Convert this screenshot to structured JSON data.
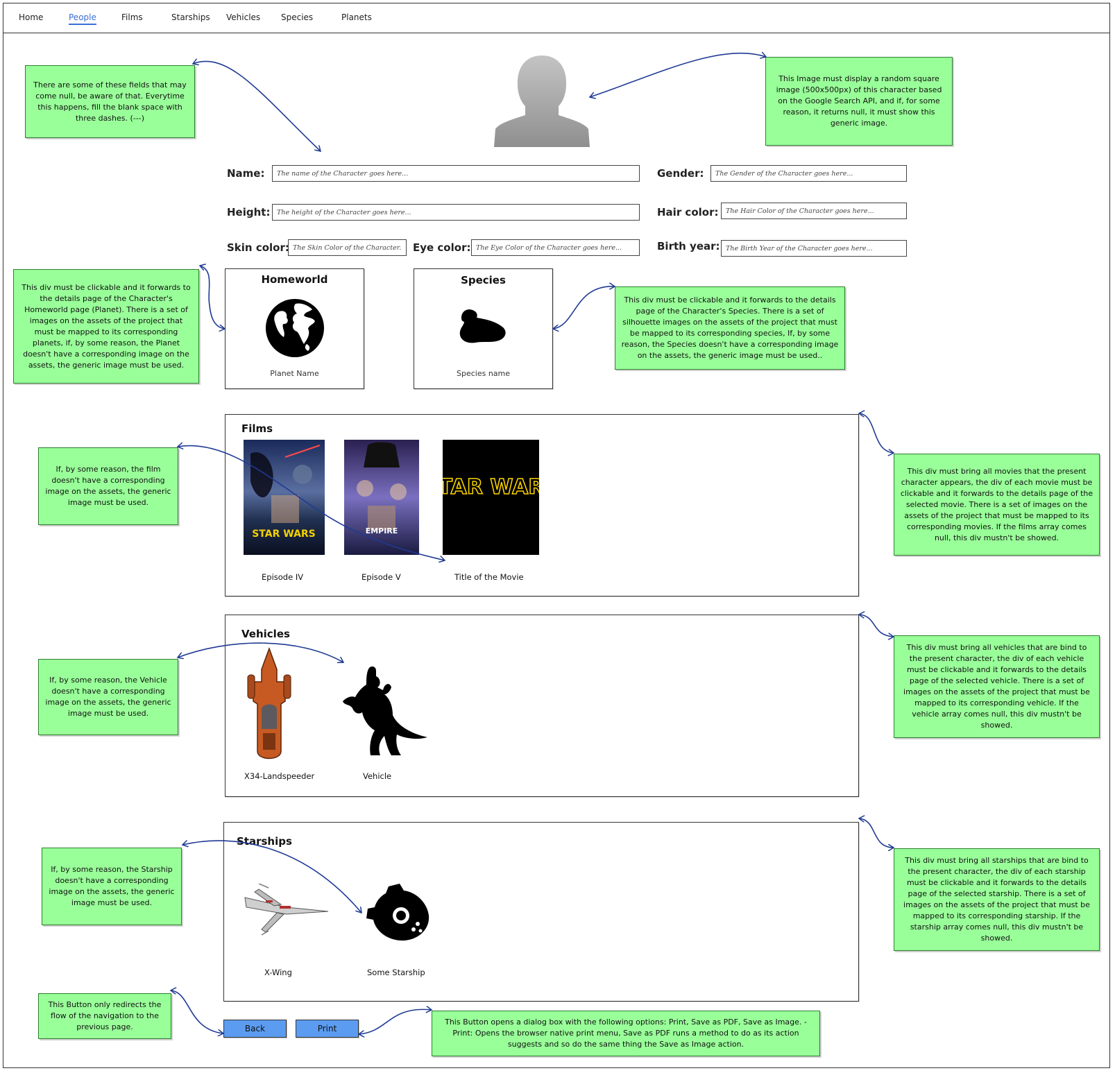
{
  "nav": {
    "items": [
      "Home",
      "People",
      "Films",
      "Starships",
      "Vehicles",
      "Species",
      "Planets"
    ],
    "active": "People"
  },
  "notes": {
    "null_fields": "There are some of these fields that may come null, be aware of that. Everytime this happens, fill the blank space with three dashes. (---)",
    "image": "This Image must display a random square image (500x500px) of this character based on the Google Search API, and if, for some reason, it returns null, it must show this generic image.",
    "homeworld": "This div must be clickable and it forwards to the details page of the Character's Homeworld page (Planet). There is a set of images on the assets of the project that must be mapped to its corresponding planets, if, by some reason, the Planet doesn't have a corresponding image on the assets, the generic image must be used.",
    "species": "This div must be clickable and it forwards to the details page of the Character's Species. There is a set of silhouette images on the assets of the project that must be mapped to its corresponding species, If, by some reason, the Species doesn't have a corresponding image on the assets, the generic image must be used..",
    "film_image": "If, by some reason, the film doesn't have a corresponding image on the assets, the generic image must be used.",
    "films": "This div must bring all movies that the present character appears, the div of each movie must be clickable and it forwards to the details page of the selected movie. There is a set of images on the assets of the project that must be mapped to its corresponding movies. If the films array comes null, this div mustn't be showed.",
    "vehicle_image": "If, by some reason, the Vehicle doesn't have a corresponding image on the assets, the generic image must be used.",
    "vehicles": "This div must bring all vehicles that are bind to the present character, the div of each vehicle must be clickable and it forwards to the details page of the selected vehicle. There is a set of images on the assets of the project that must be mapped to its corresponding vehicle. If the vehicle array comes null, this div mustn't be showed.",
    "starship_image": "If, by some reason, the Starship doesn't have a corresponding image on the assets, the generic image must be used.",
    "starships": "This div must bring all starships that are bind to the present character, the div of each starship must be clickable and it forwards to the details page of the selected starship. There is a set of images on the assets of the project that must be mapped to its corresponding starship. If the starship array comes null, this div mustn't be showed.",
    "back": "This Button only redirects the flow of the navigation to the previous page.",
    "print": "This Button opens a dialog box with the following options: Print, Save as PDF, Save as Image. - Print: Opens the browser native print menu, Save as PDF runs a method to do as its action suggests and so do the same thing the Save as Image action."
  },
  "fields": {
    "name": {
      "label": "Name:",
      "placeholder": "The name of the Character goes here..."
    },
    "gender": {
      "label": "Gender:",
      "placeholder": "The Gender of the Character goes here..."
    },
    "height": {
      "label": "Height:",
      "placeholder": "The height of the Character goes here..."
    },
    "hair": {
      "label": "Hair color:",
      "placeholder": "The Hair Color of the Character goes here..."
    },
    "skin": {
      "label": "Skin color:",
      "placeholder": "The Skin Color of the Character..."
    },
    "eye": {
      "label": "Eye color:",
      "placeholder": "The Eye Color of the Character goes here..."
    },
    "birth": {
      "label": "Birth year:",
      "placeholder": "The Birth Year of the Character goes here..."
    }
  },
  "homeworld": {
    "title": "Homeworld",
    "caption": "Planet Name",
    "icon": "globe-icon"
  },
  "species": {
    "title": "Species",
    "caption": "Species name",
    "icon": "species-silhouette-icon"
  },
  "films": {
    "title": "Films",
    "items": [
      {
        "caption": "Episode IV",
        "poster_text": "STAR WARS"
      },
      {
        "caption": "Episode V",
        "poster_text": "EMPIRE"
      },
      {
        "caption": "Title of the Movie",
        "poster_text": "STAR WARS"
      }
    ]
  },
  "vehicles": {
    "title": "Vehicles",
    "items": [
      {
        "caption": "X34-Landspeeder"
      },
      {
        "caption": "Vehicle"
      }
    ]
  },
  "starships": {
    "title": "Starships",
    "items": [
      {
        "caption": "X-Wing"
      },
      {
        "caption": "Some Starship"
      }
    ]
  },
  "buttons": {
    "back": "Back",
    "print": "Print"
  },
  "colors": {
    "note_bg": "#99ff99",
    "button_bg": "#5b9cf0",
    "arrow": "#1f3a93",
    "nav_active": "#3a6fd8",
    "poster_yellow": "#f5d000"
  }
}
